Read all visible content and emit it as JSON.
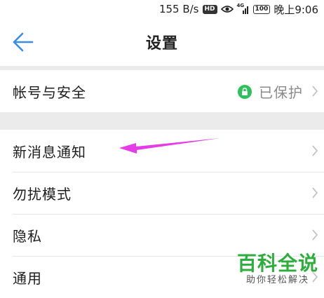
{
  "status_bar": {
    "speed": "155 B/s",
    "hd_label": "HD",
    "network_tag": "4G",
    "battery": "100",
    "time": "晚上9:06"
  },
  "header": {
    "back_icon": "back-arrow-icon",
    "title": "设置"
  },
  "groups": [
    {
      "items": [
        {
          "label": "帐号与安全",
          "status": "已保护",
          "status_icon": "lock-icon"
        }
      ]
    },
    {
      "items": [
        {
          "label": "新消息通知"
        },
        {
          "label": "勿扰模式"
        },
        {
          "label": "隐私"
        },
        {
          "label": "通用"
        }
      ]
    }
  ],
  "annotation": {
    "color": "#e63ce8",
    "points_to": "新消息通知"
  },
  "watermark": {
    "main": "百科全说",
    "sub": "助你轻松解决"
  },
  "colors": {
    "accent": "#3a8ee6",
    "lock_green": "#2ec05a",
    "background": "#ebebeb",
    "watermark_green": "#2dae3c"
  }
}
